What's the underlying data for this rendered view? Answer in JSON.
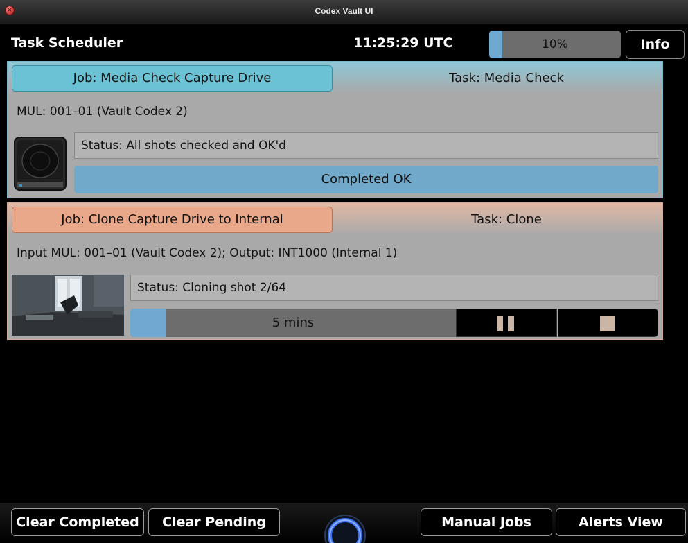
{
  "window": {
    "title": "Codex Vault UI"
  },
  "header": {
    "title": "Task Scheduler",
    "clock": "11:25:29 UTC",
    "progress_percent": 10,
    "progress_label": "10%",
    "info_label": "Info"
  },
  "jobs": [
    {
      "job_label": "Job: Media Check Capture Drive",
      "task_label": "Task: Media Check",
      "mul_line": "MUL: 001–01 (Vault Codex 2)",
      "status": "Status: All shots checked and OK'd",
      "result": "Completed OK",
      "accent": "#6ac2d4",
      "icon": "drive-icon"
    },
    {
      "job_label": "Job: Clone Capture Drive to Internal",
      "task_label": "Task: Clone",
      "mul_line": "Input MUL: 001–01 (Vault Codex 2); Output: INT1000 (Internal 1)",
      "status": "Status: Cloning shot 2/64",
      "progress_percent": 11,
      "eta": "5 mins",
      "accent": "#e9a88a",
      "icon": "shot-thumbnail"
    }
  ],
  "footer": {
    "clear_completed": "Clear Completed",
    "clear_pending": "Clear Pending",
    "manual_jobs": "Manual Jobs",
    "alerts_view": "Alerts View"
  }
}
